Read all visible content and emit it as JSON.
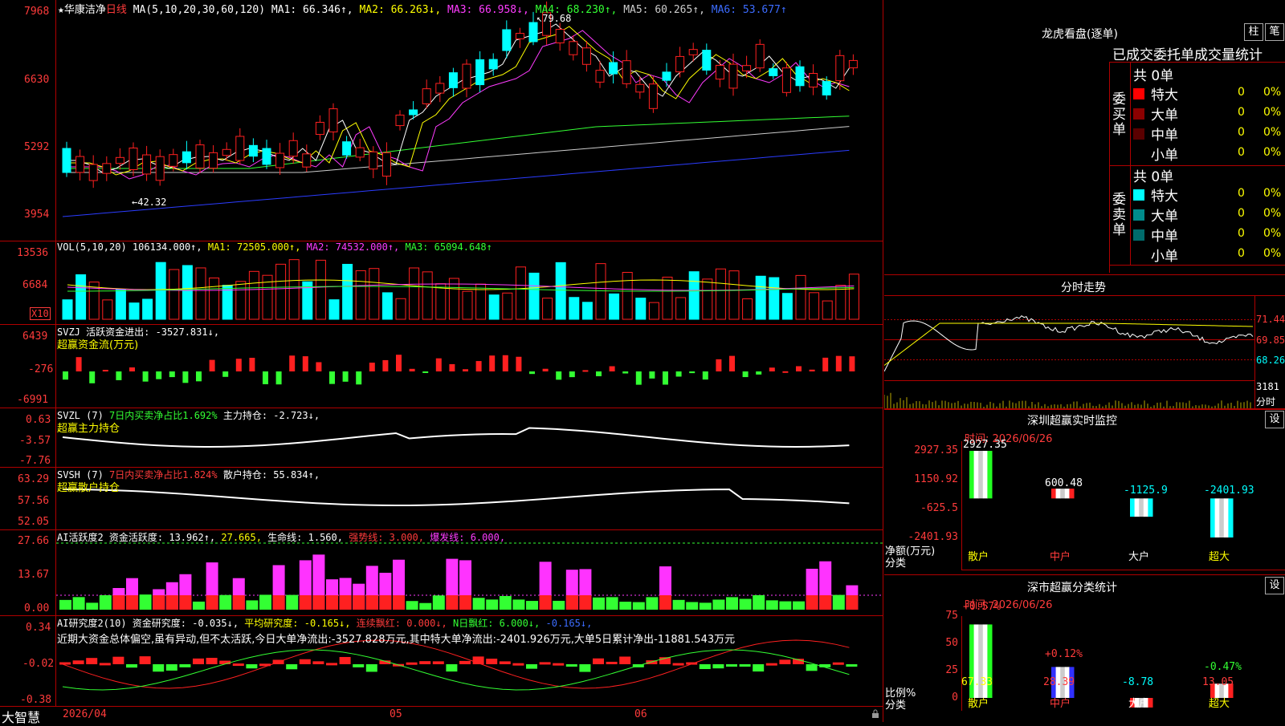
{
  "stock": {
    "star": "★",
    "name": "华康洁净",
    "period": "日线"
  },
  "legend_main": [
    {
      "t": "MA(5,10,20,30,60,120)",
      "c": "#ffffff"
    },
    {
      "t": " MA1: 66.346↑,",
      "c": "#ffffff"
    },
    {
      "t": " MA2: 66.263↓,",
      "c": "#ffff00"
    },
    {
      "t": " MA3: 66.958↓,",
      "c": "#ff3cff"
    },
    {
      "t": " MA4: 68.230↑,",
      "c": "#33ff33"
    },
    {
      "t": " MA5: 60.265↑,",
      "c": "#cccccc"
    },
    {
      "t": " MA6: 53.677↑",
      "c": "#3c6cff"
    }
  ],
  "main_axis": [
    "7968",
    "6630",
    "5292",
    "3954"
  ],
  "main_high_label": "79.68",
  "main_low_label": "42.32",
  "vol": {
    "legend": [
      {
        "t": "VOL(5,10,20)",
        "c": "#ffffff"
      },
      {
        "t": " 106134.000↑,",
        "c": "#ffffff"
      },
      {
        "t": " MA1: 72505.000↑,",
        "c": "#ffff00"
      },
      {
        "t": " MA2: 74532.000↑,",
        "c": "#ff3cff"
      },
      {
        "t": " MA3: 65094.648↑",
        "c": "#33ff33"
      }
    ],
    "axis": [
      "13536",
      "6684"
    ],
    "unit": "X10"
  },
  "svzj": {
    "legend": [
      {
        "t": "SVZJ  活跃资金进出: -3527.831↓,",
        "c": "#ffffff"
      }
    ],
    "sub": "超赢资金流(万元)",
    "axis": [
      "6439",
      "-276",
      "-6991"
    ]
  },
  "svzl": {
    "legend": [
      {
        "t": "SVZL (7) ",
        "c": "#ffffff"
      },
      {
        "t": "7日内买卖净占比1.692%",
        "c": "#33ff33"
      },
      {
        "t": " 主力持仓: -2.723↓,",
        "c": "#ffffff"
      }
    ],
    "sub": "超赢主力持仓",
    "axis": [
      "0.63",
      "-3.57",
      "-7.76"
    ]
  },
  "svsh": {
    "legend": [
      {
        "t": "SVSH (7) ",
        "c": "#ffffff"
      },
      {
        "t": "7日内买卖净占比1.824%",
        "c": "#ff3b3b"
      },
      {
        "t": " 散户持仓: 55.834↑,",
        "c": "#ffffff"
      }
    ],
    "sub": "超赢散户持仓",
    "axis": [
      "63.29",
      "57.56",
      "52.05"
    ]
  },
  "ai1": {
    "legend": [
      {
        "t": "AI活跃度2 资金活跃度: 13.962↑,",
        "c": "#ffffff"
      },
      {
        "t": " 27.665,",
        "c": "#ffff00"
      },
      {
        "t": " 生命线: 1.560,",
        "c": "#ffffff"
      },
      {
        "t": " 强势线: 3.000,",
        "c": "#ff3b3b"
      },
      {
        "t": " 爆发线: 6.000,",
        "c": "#ff3cff"
      }
    ],
    "axis": [
      "27.66",
      "13.67",
      "0.00"
    ]
  },
  "ai2": {
    "legend": [
      {
        "t": "AI研究度2(10) 资金研究度: -0.035↓,",
        "c": "#ffffff"
      },
      {
        "t": " 平均研究度: -0.165↓,",
        "c": "#ffff00"
      },
      {
        "t": " 连续飘红: 0.000↓,",
        "c": "#ff3b3b"
      },
      {
        "t": " N日飘红: 6.000↓,",
        "c": "#33ff33"
      },
      {
        "t": " -0.165↓,",
        "c": "#3c6cff"
      }
    ],
    "comment": "近期大资金总体偏空,虽有异动,但不太活跃,今日大单净流出:-3527.828万元,其中特大单净流出:-2401.926万元,大单5日累计净出-11881.543万元",
    "axis": [
      "0.34",
      "-0.02",
      "-0.38"
    ]
  },
  "bottom": {
    "brand": "大智慧",
    "date": "2026/04",
    "m1": "05",
    "m2": "06"
  },
  "right": {
    "lhb_title": "龙虎看盘(逐单)",
    "btn_zhu": "柱",
    "btn_bi": "笔",
    "tabs_line": "已成交委托单成交量统计",
    "buy_label": "委买单",
    "sell_label": "委卖单",
    "buy_total": "共 0单",
    "sell_total": "共 0单",
    "buy_rows": [
      {
        "name": "特大",
        "n": "0",
        "p": "0%",
        "color": "#ff0000"
      },
      {
        "name": "大单",
        "n": "0",
        "p": "0%",
        "color": "#8b0000"
      },
      {
        "name": "中单",
        "n": "0",
        "p": "0%",
        "color": "#5a0000"
      },
      {
        "name": "小单",
        "n": "0",
        "p": "0%",
        "color": ""
      }
    ],
    "sell_rows": [
      {
        "name": "特大",
        "n": "0",
        "p": "0%",
        "color": "#00ffff"
      },
      {
        "name": "大单",
        "n": "0",
        "p": "0%",
        "color": "#008b8b"
      },
      {
        "name": "中单",
        "n": "0",
        "p": "0%",
        "color": "#006b6b"
      },
      {
        "name": "小单",
        "n": "0",
        "p": "0%",
        "color": ""
      }
    ],
    "fs_title": "分时走势",
    "fs_axis": [
      "71.44",
      "69.85",
      "68.26"
    ],
    "fs_vol": "3181",
    "fs_vol_unit": "分时",
    "monitor_title": "深圳超赢实时监控",
    "monitor_set": "设",
    "monitor_time": "时间: 2026/06/26",
    "monitor_axis": [
      "2927.35",
      "1150.92",
      "-625.5",
      "-2401.93"
    ],
    "monitor_unit1": "净额(万元)",
    "monitor_unit2": "分类",
    "stat_title": "深市超赢分类统计",
    "stat_set": "设",
    "stat_time": "时间: 2026/06/26",
    "stat_axis": [
      "75",
      "50",
      "25",
      "0"
    ],
    "stat_unit1": "比例%",
    "stat_unit2": "分类",
    "categories": [
      "散户",
      "中户",
      "大户",
      "超大"
    ]
  },
  "chart_data": [
    {
      "type": "bar",
      "title": "深圳超赢实时监控",
      "ylabel": "净额(万元)",
      "categories": [
        "散户",
        "中户",
        "大户",
        "超大"
      ],
      "values": [
        2927.35,
        600.48,
        -1125.9,
        -2401.93
      ],
      "labels": [
        "2927.35",
        "600.48",
        "-1125.9",
        "-2401.93"
      ],
      "ylim": [
        -2401.93,
        2927.35
      ]
    },
    {
      "type": "bar",
      "title": "深市超赢分类统计",
      "ylabel": "比例%",
      "categories": [
        "散户",
        "中户",
        "大户",
        "超大"
      ],
      "values": [
        67.33,
        28.39,
        -8.78,
        13.05
      ],
      "bottom_labels": [
        "67.33",
        "28.39",
        "-8.78",
        "13.05"
      ],
      "top_labels": [
        "+0.57%",
        "+0.12%",
        "",
        "-0.47%"
      ],
      "ylim": [
        0,
        75
      ]
    }
  ],
  "colors": {
    "grid": "#b00000",
    "up": "#ff2020",
    "down": "#00ffff"
  }
}
